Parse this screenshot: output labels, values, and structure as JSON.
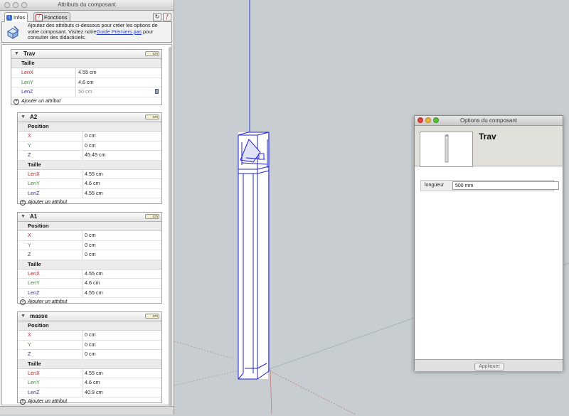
{
  "left_panel": {
    "title": "Attributs du composant",
    "tabs": [
      {
        "label": "Infos"
      },
      {
        "label": "Fonctions"
      }
    ],
    "info": {
      "text_before": "Ajoutez des attributs ci-dessous pour créer les options de votre composant. Visitez notre",
      "link": "Guide Premiers pas",
      "text_after": " pour consulter des didacticiels."
    },
    "unit_button": "cm",
    "add_attribute": "Ajouter un attribut",
    "group_position": "Position",
    "group_size": "Taille"
  },
  "components": [
    {
      "name": "Trav",
      "rows": [
        {
          "key": "LenX",
          "value": "4.55 cm"
        },
        {
          "key": "LenY",
          "value": "4.6 cm"
        },
        {
          "key": "LenZ",
          "value": "50 cm"
        }
      ]
    },
    {
      "name": "A2",
      "position": [
        {
          "key": "X",
          "value": "0 cm"
        },
        {
          "key": "Y",
          "value": "0 cm"
        },
        {
          "key": "Z",
          "value": "45.45 cm"
        }
      ],
      "size": [
        {
          "key": "LenX",
          "value": "4.55 cm"
        },
        {
          "key": "LenY",
          "value": "4.6 cm"
        },
        {
          "key": "LenZ",
          "value": "4.55 cm"
        }
      ]
    },
    {
      "name": "A1",
      "position": [
        {
          "key": "X",
          "value": "0 cm"
        },
        {
          "key": "Y",
          "value": "0 cm"
        },
        {
          "key": "Z",
          "value": "0 cm"
        }
      ],
      "size": [
        {
          "key": "LenX",
          "value": "4.55 cm"
        },
        {
          "key": "LenY",
          "value": "4.6 cm"
        },
        {
          "key": "LenZ",
          "value": "4.55 cm"
        }
      ]
    },
    {
      "name": "masse",
      "position": [
        {
          "key": "X",
          "value": "0 cm"
        },
        {
          "key": "Y",
          "value": "0 cm"
        },
        {
          "key": "Z",
          "value": "0 cm"
        }
      ],
      "size": [
        {
          "key": "LenX",
          "value": "4.55 cm"
        },
        {
          "key": "LenY",
          "value": "4.6 cm"
        },
        {
          "key": "LenZ",
          "value": "40.9 cm"
        }
      ]
    }
  ],
  "dialog": {
    "title": "Options du composant",
    "component_name": "Trav",
    "field_label": "longueur",
    "field_value": "500 mm",
    "apply_button": "Appliquer"
  },
  "colors": {
    "axis_red": "#c02020",
    "axis_green": "#2c8a2c",
    "axis_blue": "#2c2ca0",
    "selection_blue": "#1f1fd8",
    "viewport_bg": "#c7cdd0"
  }
}
